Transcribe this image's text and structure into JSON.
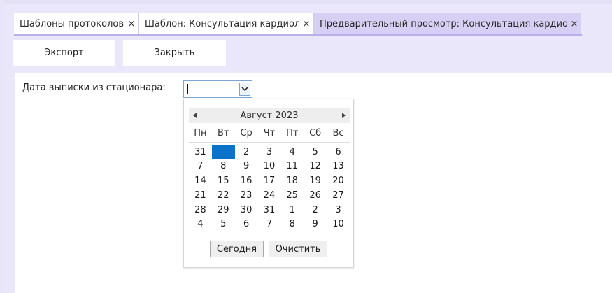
{
  "tabs": [
    {
      "label": "Шаблоны протоколов",
      "close": "×"
    },
    {
      "label": "Шаблон: Консультация кардиол...",
      "close": "×"
    },
    {
      "label": "Предварительный просмотр: Консультация кардиол...",
      "close": "×"
    }
  ],
  "toolbar": {
    "export_label": "Экспорт",
    "close_label": "Закрыть"
  },
  "form": {
    "date_label": "Дата выписки из стационара:",
    "date_value": ""
  },
  "calendar": {
    "month_label": "Август 2023",
    "weekdays": [
      "Пн",
      "Вт",
      "Ср",
      "Чт",
      "Пт",
      "Сб",
      "Вс"
    ],
    "weeks": [
      [
        "31",
        "1",
        "2",
        "3",
        "4",
        "5",
        "6"
      ],
      [
        "7",
        "8",
        "9",
        "10",
        "11",
        "12",
        "13"
      ],
      [
        "14",
        "15",
        "16",
        "17",
        "18",
        "19",
        "20"
      ],
      [
        "21",
        "22",
        "23",
        "24",
        "25",
        "26",
        "27"
      ],
      [
        "28",
        "29",
        "30",
        "31",
        "1",
        "2",
        "3"
      ],
      [
        "4",
        "5",
        "6",
        "7",
        "8",
        "9",
        "10"
      ]
    ],
    "selected_day": "1",
    "today_label": "Сегодня",
    "clear_label": "Очистить"
  },
  "colors": {
    "accent": "#0a72c9",
    "active_tab": "#d7d0f4",
    "background": "#ebe7fb"
  },
  "icons": {
    "prev": "chevron-left-icon",
    "next": "chevron-right-icon",
    "dropdown": "chevron-down-icon"
  }
}
